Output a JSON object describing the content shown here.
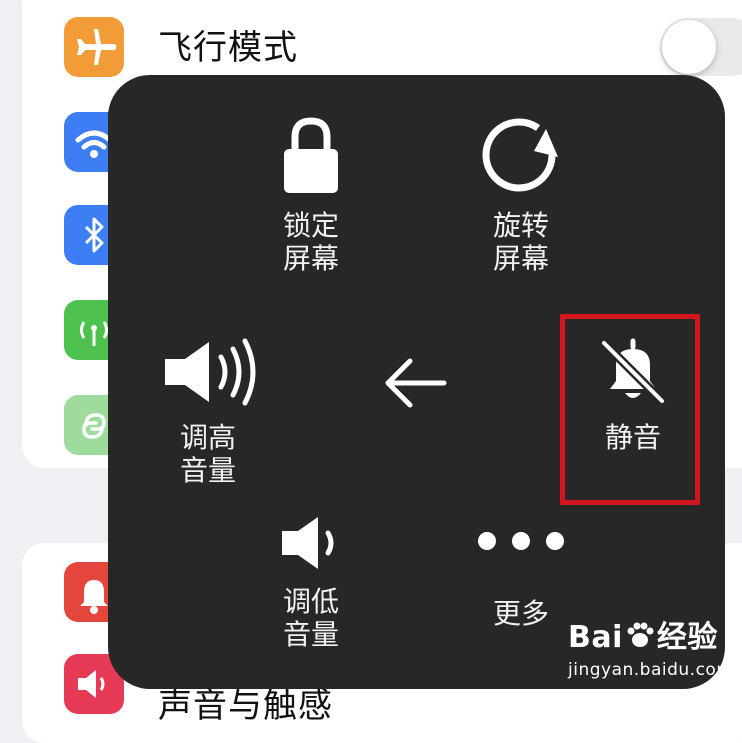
{
  "settings": {
    "airplane_label": "飞行模式",
    "bottom_partial_label": "声音与触感"
  },
  "menu": {
    "lock_screen": [
      "锁定",
      "屏幕"
    ],
    "rotate_screen": [
      "旋转",
      "屏幕"
    ],
    "volume_up": [
      "调高",
      "音量"
    ],
    "mute": "静音",
    "volume_down": [
      "调低",
      "音量"
    ],
    "more": "更多"
  },
  "watermark": {
    "brand_left": "Bai",
    "brand_right": "经验",
    "url": "jingyan.baidu.com"
  },
  "colors": {
    "airplane": "#f29c38",
    "wifi": "#3d7ef5",
    "bluetooth": "#3d7ef5",
    "cellular": "#4fc14e",
    "hotspot": "#9edb9d",
    "notifications": "#e4453c",
    "sounds": "#e63a56",
    "highlight": "#d3161e",
    "panel": "#272727"
  }
}
